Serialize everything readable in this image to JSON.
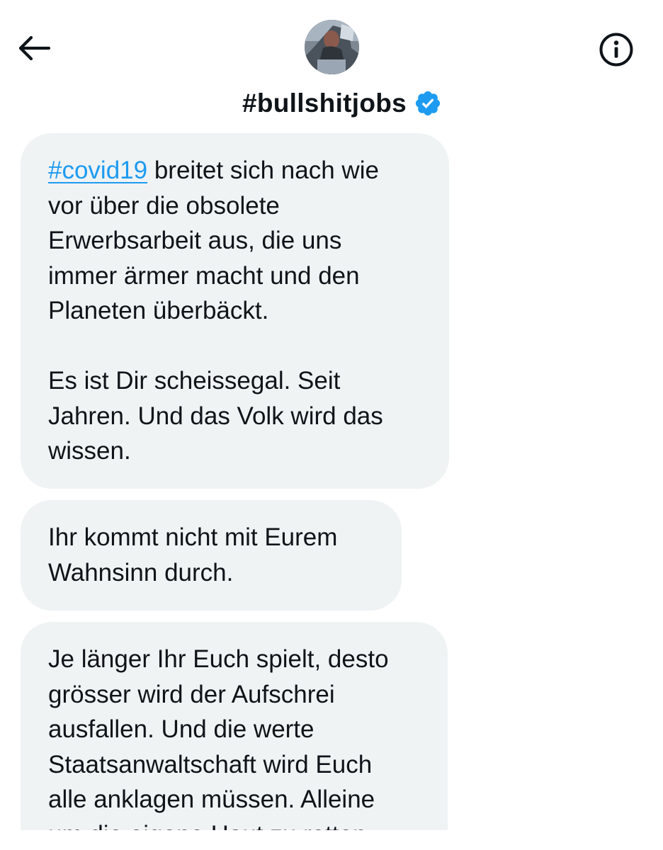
{
  "header": {
    "title": "#bullshitjobs",
    "back_icon": "arrow-left-icon",
    "info_icon": "info-circle-icon",
    "verified_icon": "verified-badge-icon",
    "verified_color": "#1d9bf0"
  },
  "messages": [
    {
      "hashtag": "#covid19",
      "text_after_hashtag": " breitet sich nach wie\nvor über die obsolete\nErwerbsarbeit aus, die uns\nimmer ärmer macht und den\nPlaneten überbäckt.",
      "paragraph2": "Es ist Dir scheissegal. Seit\nJahren. Und das Volk wird das\nwissen."
    },
    {
      "text": "Ihr kommt nicht mit Eurem\nWahnsinn durch."
    },
    {
      "text": "Je länger Ihr Euch spielt, desto\ngrösser wird der Aufschrei\nausfallen. Und die werte\nStaatsanwaltschaft wird Euch\nalle anklagen müssen. Alleine\num die eigene Haut zu retten."
    }
  ],
  "colors": {
    "bubble_bg": "#eff3f4",
    "text": "#0f1419",
    "link": "#1d9bf0"
  }
}
